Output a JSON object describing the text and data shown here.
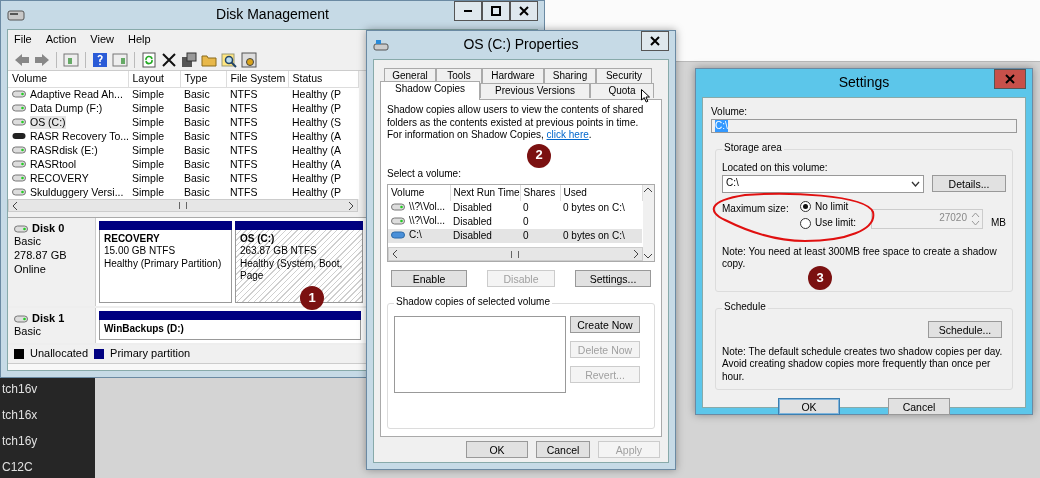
{
  "desktop": {
    "sidebar_labels": [
      "tch16v",
      "tch16x",
      "tch16y",
      "C12C"
    ]
  },
  "disk_management": {
    "title": "Disk Management",
    "menu": [
      "File",
      "Action",
      "View",
      "Help"
    ],
    "columns": [
      "Volume",
      "Layout",
      "Type",
      "File System",
      "Status"
    ],
    "volumes": [
      {
        "cells": [
          "Adaptive Read Ah...",
          "Simple",
          "Basic",
          "NTFS",
          "Healthy (P"
        ],
        "selected": false,
        "kind": "drive"
      },
      {
        "cells": [
          "Data Dump (F:)",
          "Simple",
          "Basic",
          "NTFS",
          "Healthy (P"
        ],
        "selected": false,
        "kind": "drive"
      },
      {
        "cells": [
          "OS (C:)",
          "Simple",
          "Basic",
          "NTFS",
          "Healthy (S"
        ],
        "selected": true,
        "kind": "drive"
      },
      {
        "cells": [
          "RASR Recovery To...",
          "Simple",
          "Basic",
          "NTFS",
          "Healthy (A"
        ],
        "selected": false,
        "kind": "removable"
      },
      {
        "cells": [
          "RASRdisk (E:)",
          "Simple",
          "Basic",
          "NTFS",
          "Healthy (A"
        ],
        "selected": false,
        "kind": "drive"
      },
      {
        "cells": [
          "RASRtool",
          "Simple",
          "Basic",
          "NTFS",
          "Healthy (A"
        ],
        "selected": false,
        "kind": "drive"
      },
      {
        "cells": [
          "RECOVERY",
          "Simple",
          "Basic",
          "NTFS",
          "Healthy (P"
        ],
        "selected": false,
        "kind": "drive"
      },
      {
        "cells": [
          "Skulduggery Versi...",
          "Simple",
          "Basic",
          "NTFS",
          "Healthy (P"
        ],
        "selected": false,
        "kind": "drive"
      }
    ],
    "disks": [
      {
        "name": "Disk 0",
        "details": [
          "Basic",
          "278.87 GB",
          "Online"
        ],
        "partitions": [
          {
            "name": "RECOVERY",
            "lines": [
              "15.00 GB NTFS",
              "Healthy (Primary Partition)"
            ],
            "selected": false
          },
          {
            "name": "OS  (C:)",
            "lines": [
              "263.87 GB NTFS",
              "Healthy (System, Boot, Page"
            ],
            "selected": true
          }
        ]
      },
      {
        "name": "Disk 1",
        "details": [
          "Basic"
        ],
        "partitions": [
          {
            "name": "WinBackups (D:)",
            "selected": false
          }
        ]
      }
    ],
    "legend": [
      {
        "label": "Unallocated",
        "color": "#000000"
      },
      {
        "label": "Primary partition",
        "color": "#000080"
      }
    ]
  },
  "properties": {
    "title": "OS (C:) Properties",
    "tab_rows": [
      [
        {
          "label": "General",
          "selected": false
        },
        {
          "label": "Tools",
          "selected": false
        },
        {
          "label": "Hardware",
          "selected": false
        },
        {
          "label": "Sharing",
          "selected": false
        },
        {
          "label": "Security",
          "selected": false
        }
      ],
      [
        {
          "label": "Shadow Copies",
          "selected": true
        },
        {
          "label": "Previous Versions",
          "selected": false
        },
        {
          "label": "Quota",
          "selected": false
        }
      ]
    ],
    "description": "Shadow copies allow users to view the contents of shared folders as the contents existed at previous points in time. For information on Shadow Copies, ",
    "link": "click here",
    "link_suffix": ".",
    "select_label": "Select a volume:",
    "volume_columns": [
      "Volume",
      "Next Run Time",
      "Shares",
      "Used"
    ],
    "volumes": [
      {
        "volume": "\\\\?\\Vol...",
        "next_run": "Disabled",
        "shares": "0",
        "used": "0 bytes on C:\\",
        "selected": false,
        "kind": "volume"
      },
      {
        "volume": "\\\\?\\Vol...",
        "next_run": "Disabled",
        "shares": "0",
        "selected": false,
        "kind": "volume"
      },
      {
        "volume": "C:\\",
        "next_run": "Disabled",
        "shares": "0",
        "used": "0 bytes on C:\\",
        "selected": true,
        "kind": "system"
      }
    ],
    "actions": [
      {
        "label": "Enable",
        "disabled": false
      },
      {
        "label": "Disable",
        "disabled": true
      },
      {
        "label": "Settings...",
        "disabled": false
      }
    ],
    "group_title": "Shadow copies of selected volume",
    "copy_actions": [
      {
        "label": "Create Now",
        "disabled": false
      },
      {
        "label": "Delete Now",
        "disabled": true
      },
      {
        "label": "Revert...",
        "disabled": true
      }
    ],
    "footer": [
      {
        "label": "OK",
        "disabled": false
      },
      {
        "label": "Cancel",
        "disabled": false
      },
      {
        "label": "Apply",
        "disabled": true
      }
    ]
  },
  "settings": {
    "title": "Settings",
    "volume_label": "Volume:",
    "volume_value": "C:\\",
    "value_highlighted": true,
    "storage_title": "Storage area",
    "located_label": "Located on this volume:",
    "located_value": "C:\\",
    "details_button": "Details...",
    "max_size_label": "Maximum size:",
    "limit_options": [
      {
        "label": "No limit",
        "selected": true
      },
      {
        "label": "Use limit:",
        "selected": false
      }
    ],
    "limit_value": "27020",
    "limit_disabled": true,
    "limit_unit": "MB",
    "storage_note": "Note: You need at least 300MB free space to create a shadow copy.",
    "schedule_title": "Schedule",
    "schedule_button": "Schedule...",
    "schedule_note": "Note: The default schedule creates two shadow copies per day. Avoid creating shadow copies more frequently than once per hour.",
    "footer": [
      {
        "label": "OK",
        "default": true
      },
      {
        "label": "Cancel",
        "default": false
      }
    ]
  },
  "annotations": [
    {
      "label": "1"
    },
    {
      "label": "2"
    },
    {
      "label": "3"
    }
  ]
}
